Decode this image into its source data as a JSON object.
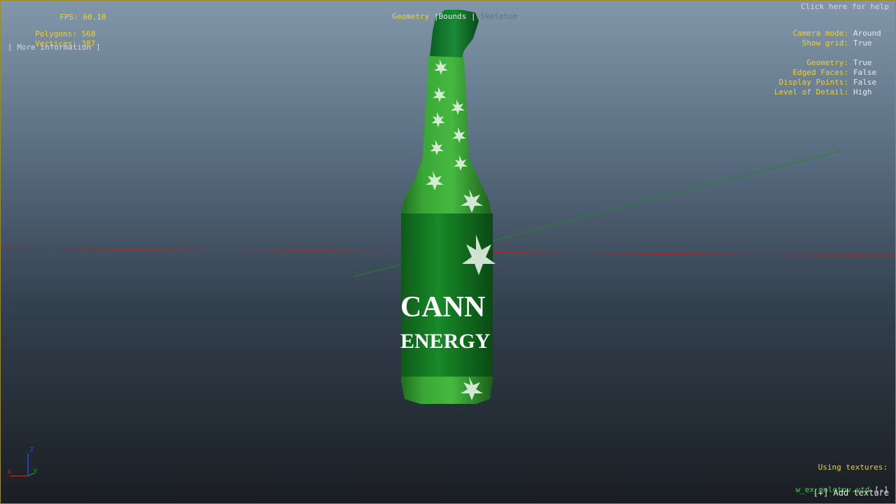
{
  "hud": {
    "fps_label": "FPS:",
    "fps_value": "60.10",
    "polygons_label": "Polygons:",
    "polygons_value": "568",
    "vertices_label": "Vertices:",
    "vertices_value": "387",
    "more_info": "[ More information ]",
    "help": "Click here for help"
  },
  "tabs": [
    {
      "label": "Geometry",
      "state": "active"
    },
    {
      "label": "Bounds",
      "state": "normal"
    },
    {
      "label": "Skeleton",
      "state": "disabled"
    }
  ],
  "tab_separator": "|",
  "settings": [
    {
      "label": "Camera mode:",
      "value": "Around"
    },
    {
      "label": "Show grid:",
      "value": "True"
    },
    {
      "label": "Geometry:",
      "value": "True"
    },
    {
      "label": "Edged Faces:",
      "value": "False"
    },
    {
      "label": "Display Points:",
      "value": "False"
    },
    {
      "label": "Level of Detail:",
      "value": "High"
    }
  ],
  "textures": {
    "title": "Using textures:",
    "file": "w_ex_molotov.ytd",
    "remove": "[-]",
    "add": "[+] Add texture"
  },
  "axes": {
    "x": "x",
    "y": "y",
    "z": "z"
  },
  "model": {
    "label_line1": "CANN",
    "label_line2": "ENERGY"
  },
  "colors": {
    "hud_yellow": "#f2d02a",
    "hud_white": "#e8e8e8",
    "texture_green": "#3fd14a",
    "bottle_green": "#2f9a2c",
    "axis_red": "#b22222",
    "axis_green": "#1e8a1e",
    "axis_blue": "#2a4cd0"
  }
}
